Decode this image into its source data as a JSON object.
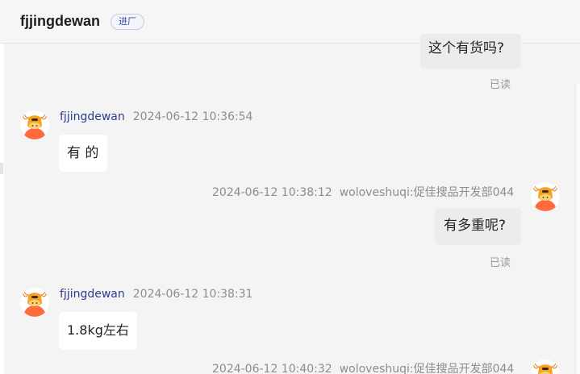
{
  "header": {
    "title": "fjjingdewan",
    "tag": "进厂"
  },
  "messages": [
    {
      "side": "me",
      "text": "这个有货吗?",
      "status": "已读"
    },
    {
      "side": "them",
      "name": "fjjingdewan",
      "time": "2024-06-12 10:36:54",
      "text": "有 的"
    },
    {
      "side": "me",
      "time": "2024-06-12 10:38:12",
      "name": "woloveshuqi:促佳搜品开发部044",
      "text": "有多重呢?",
      "status": "已读"
    },
    {
      "side": "them",
      "name": "fjjingdewan",
      "time": "2024-06-12 10:38:31",
      "text": "1.8kg左右"
    },
    {
      "side": "me",
      "time": "2024-06-12 10:40:32",
      "name": "woloveshuqi:促佳搜品开发部044"
    }
  ],
  "icons": {
    "avatar": "bull-avatar-icon"
  },
  "colors": {
    "sender_name": "#2b3d8f",
    "tag_text": "#2f49a8",
    "avatar_orange": "#ff6b3d",
    "page_bg": "#f4f4f4"
  }
}
